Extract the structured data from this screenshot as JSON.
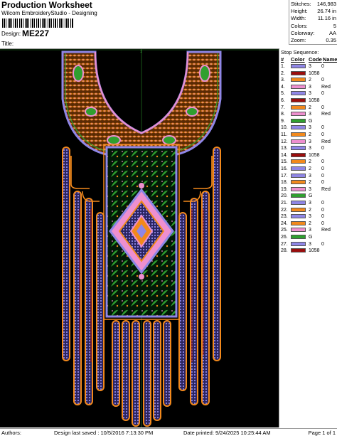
{
  "header": {
    "title": "Production Worksheet",
    "subtitle": "Wilcom EmbroideryStudio - Designing",
    "design_label": "Design:",
    "design_value": "ME227",
    "title_label": "Title:"
  },
  "stats": [
    {
      "k": "Stitches:",
      "v": "146,983"
    },
    {
      "k": "Height:",
      "v": "26.74 in"
    },
    {
      "k": "Width:",
      "v": "11.16 in"
    },
    {
      "k": "Colors:",
      "v": "5"
    },
    {
      "k": "Colorway:",
      "v": "AA"
    },
    {
      "k": "Zoom:",
      "v": "0.35"
    }
  ],
  "canvas": {
    "origin_label": "1"
  },
  "sequence": {
    "title": "Stop Sequence:",
    "headers": {
      "num": "#",
      "color": "Color",
      "code": "Code",
      "name": "Name"
    },
    "rows": [
      {
        "n": "1.",
        "color": "#8f86e6",
        "code": "3",
        "name": "0"
      },
      {
        "n": "2.",
        "color": "#9b0d0d",
        "code": "1058",
        "name": ""
      },
      {
        "n": "3.",
        "color": "#f2891c",
        "code": "2",
        "name": "0"
      },
      {
        "n": "4.",
        "color": "#ee8fcf",
        "code": "3",
        "name": "Red"
      },
      {
        "n": "5.",
        "color": "#8f86e6",
        "code": "3",
        "name": "0"
      },
      {
        "n": "6.",
        "color": "#9b0d0d",
        "code": "1058",
        "name": ""
      },
      {
        "n": "7.",
        "color": "#f2891c",
        "code": "2",
        "name": "0"
      },
      {
        "n": "8.",
        "color": "#ee8fcf",
        "code": "3",
        "name": "Red"
      },
      {
        "n": "9.",
        "color": "#2f9f2f",
        "code": "G",
        "name": ""
      },
      {
        "n": "10.",
        "color": "#8f86e6",
        "code": "3",
        "name": "0"
      },
      {
        "n": "11.",
        "color": "#f2891c",
        "code": "2",
        "name": "0"
      },
      {
        "n": "12.",
        "color": "#ee8fcf",
        "code": "3",
        "name": "Red"
      },
      {
        "n": "13.",
        "color": "#8f86e6",
        "code": "3",
        "name": "0"
      },
      {
        "n": "14.",
        "color": "#9b0d0d",
        "code": "1058",
        "name": ""
      },
      {
        "n": "15.",
        "color": "#f2891c",
        "code": "2",
        "name": "0"
      },
      {
        "n": "16.",
        "color": "#8f86e6",
        "code": "2",
        "name": "0"
      },
      {
        "n": "17.",
        "color": "#8f86e6",
        "code": "3",
        "name": "0"
      },
      {
        "n": "18.",
        "color": "#f2891c",
        "code": "2",
        "name": "0"
      },
      {
        "n": "19.",
        "color": "#ee8fcf",
        "code": "3",
        "name": "Red"
      },
      {
        "n": "20.",
        "color": "#2f9f2f",
        "code": "G",
        "name": ""
      },
      {
        "n": "21.",
        "color": "#8f86e6",
        "code": "3",
        "name": "0"
      },
      {
        "n": "22.",
        "color": "#f2891c",
        "code": "2",
        "name": "0"
      },
      {
        "n": "23.",
        "color": "#8f86e6",
        "code": "3",
        "name": "0"
      },
      {
        "n": "24.",
        "color": "#f2891c",
        "code": "2",
        "name": "0"
      },
      {
        "n": "25.",
        "color": "#ee8fcf",
        "code": "3",
        "name": "Red"
      },
      {
        "n": "26.",
        "color": "#2f9f2f",
        "code": "G",
        "name": ""
      },
      {
        "n": "27.",
        "color": "#8f86e6",
        "code": "3",
        "name": "0"
      },
      {
        "n": "28.",
        "color": "#9b0d0d",
        "code": "1058",
        "name": ""
      }
    ]
  },
  "footer": {
    "authors": "Authors:",
    "saved": "Design last saved :  10/5/2016 7:13:30 PM",
    "printed": "Date printed: 9/24/2025 10:25:44 AM",
    "page": "Page 1 of 1"
  }
}
